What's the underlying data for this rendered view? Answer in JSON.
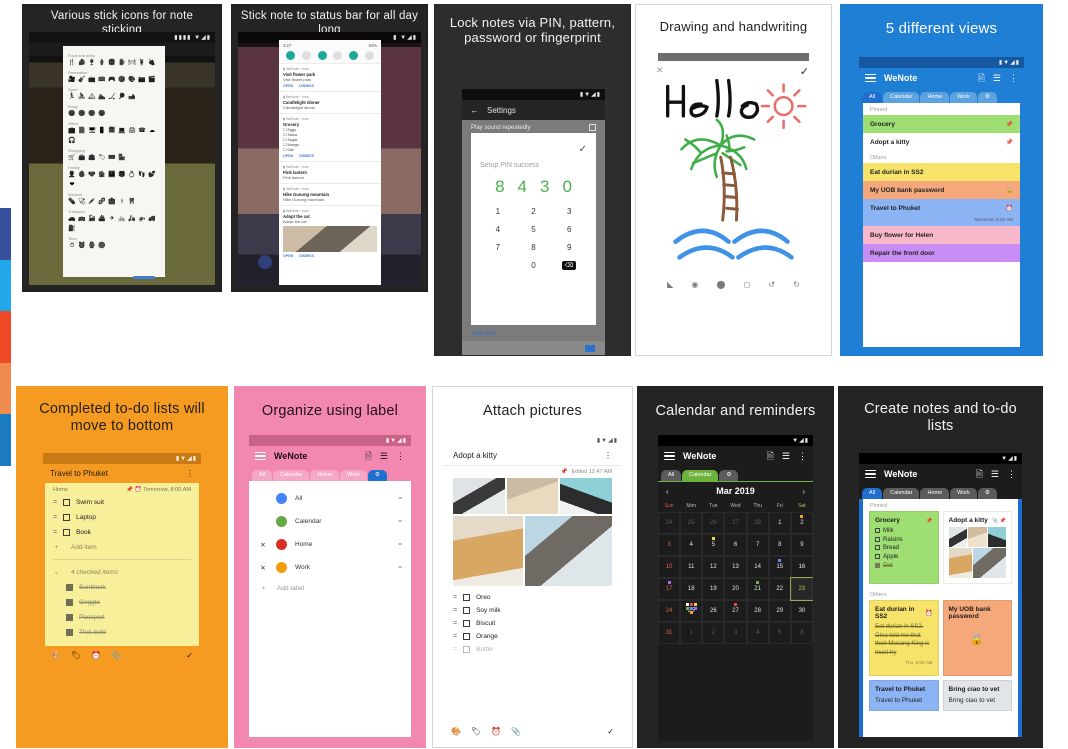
{
  "gallery": {
    "edge_strip_colors": [
      "#36509b",
      "#22a7e8",
      "#ef4824",
      "#ef8b4e",
      "#1c7cc0"
    ]
  },
  "cards": [
    {
      "id": "stick-icons",
      "title": "Various stick icons for note sticking",
      "bg": "#242424",
      "title_color": "#f2f2f2",
      "icon_picker": {
        "groups": [
          {
            "name": "Food and drink",
            "icons": [
              "🍴",
              "🍰",
              "🍷",
              "🍦",
              "🍔",
              "🍺",
              "🍽",
              "🍹",
              "🍇"
            ]
          },
          {
            "name": "Recreation",
            "icons": [
              "🎥",
              "🎸",
              "📺",
              "📖",
              "🎮",
              "🎲",
              "🎨",
              "📷",
              "🎬"
            ]
          },
          {
            "name": "Sport",
            "icons": [
              "🏃",
              "🚴",
              "🏔",
              "🏊",
              "🏒",
              "🏓",
              "🎿"
            ]
          },
          {
            "name": "Emoji",
            "icons": [
              "😀",
              "😊",
              "🙁",
              "😮"
            ]
          },
          {
            "name": "Office",
            "icons": [
              "💼",
              "📄",
              "🖥",
              "📱",
              "📅",
              "💻",
              "🖨",
              "☎",
              "☁",
              "🎧"
            ]
          },
          {
            "name": "Shopping",
            "icons": [
              "🛒",
              "👜",
              "👛",
              "🏷",
              "💳",
              "🏪"
            ]
          },
          {
            "name": "Family",
            "icons": [
              "👤",
              "👶",
              "🐶",
              "🏠",
              "👪",
              "🎁",
              "💍",
              "👣",
              "💕",
              "❤"
            ]
          },
          {
            "name": "Medical",
            "icons": [
              "💊",
              "🩺",
              "💉",
              "🧬",
              "🏥",
              "⚕",
              "🦷"
            ]
          },
          {
            "name": "Transport",
            "icons": [
              "🚗",
              "🚌",
              "🚂",
              "🚢",
              "✈",
              "🚲",
              "🛵",
              "🚁",
              "🚚",
              "⛽"
            ]
          },
          {
            "name": "Time",
            "icons": [
              "⏱",
              "⏰",
              "⌚",
              "🕒"
            ]
          }
        ]
      }
    },
    {
      "id": "status-bar-note",
      "title": "Stick note to status bar for all day long",
      "bg": "#242424",
      "title_color": "#f2f2f2",
      "notification_shade": {
        "clock": "4:27",
        "battery": "84%",
        "quick_toggles": [
          "wifi-toggle",
          "bluetooth-toggle",
          "dnd-toggle",
          "flashlight-toggle",
          "rotate-toggle",
          "airplane-toggle"
        ],
        "notifications": [
          {
            "app": "WeNote · now",
            "title": "Visit flower park",
            "body": "Visit flower park",
            "actions": [
              "OPEN",
              "DISMISS"
            ]
          },
          {
            "app": "WeNote · now",
            "title": "Candlelight dinner",
            "body": "Candlelight dinner"
          },
          {
            "app": "WeNote · now",
            "title": "Grocery",
            "items": [
              "Eggs",
              "Salsa",
              "Sugar",
              "Mango",
              "Oat"
            ],
            "actions": [
              "OPEN",
              "DISMISS"
            ]
          },
          {
            "app": "WeNote · now",
            "title": "Pink lantern",
            "body": "Pink lantern"
          },
          {
            "app": "WeNote · now",
            "title": "Hike Gunung mountain",
            "body": "Hike Gunung mountain"
          },
          {
            "app": "WeNote · now",
            "title": "Adopt the cat",
            "body": "Adopt the cat",
            "actions": [
              "OPEN",
              "DISMISS"
            ]
          }
        ]
      }
    },
    {
      "id": "lock-notes",
      "title": "Lock notes via PIN, pattern, password or fingerprint",
      "bg": "#2d2d2d",
      "title_color": "#f2f2f2",
      "settings_screen": {
        "toolbar_title": "Settings",
        "back_icon": "arrow-left-icon",
        "dim_row": "Play sound repeatedly",
        "auto_lock": "Auto lock"
      },
      "pin_dialog": {
        "message": "Setup PIN success",
        "entered": [
          "8",
          "4",
          "3",
          "0"
        ],
        "entered_color": "#4caf50",
        "keys": [
          "1",
          "2",
          "3",
          "4",
          "5",
          "6",
          "7",
          "8",
          "9",
          "",
          "0",
          "⌫"
        ],
        "confirm_icon": "check-icon"
      }
    },
    {
      "id": "drawing",
      "title": "Drawing and handwriting",
      "bg": "#ffffff",
      "title_color": "#1f1f1f",
      "canvas": {
        "handwriting_text": "Hello",
        "close_icon": "close-icon",
        "confirm_icon": "check-icon",
        "tools": [
          "brush-icon",
          "opacity-icon",
          "color-icon",
          "eraser-icon",
          "undo-icon",
          "redo-icon"
        ]
      }
    },
    {
      "id": "five-views",
      "title": "5 different views",
      "bg": "#1f7fd4",
      "title_color": "#ffffff",
      "app": {
        "name": "WeNote",
        "menu_icon": "hamburger-icon",
        "actions": [
          "new-note-icon",
          "view-list-icon",
          "overflow-menu-icon"
        ],
        "tabs": [
          "All",
          "Calendar",
          "Home",
          "Work"
        ],
        "active_tab": "All",
        "settings_tab_icon": "gear-icon",
        "sections": [
          {
            "label": "Pinned",
            "notes": [
              {
                "title": "Grocery",
                "color": "#9ede73",
                "badge": "pin-icon"
              },
              {
                "title": "Adopt a kitty",
                "color": "#ffffff",
                "badge": "pin-icon"
              }
            ]
          },
          {
            "label": "Others",
            "notes": [
              {
                "title": "Eat durian in SS2",
                "color": "#f7e36a",
                "badge": ""
              },
              {
                "title": "My UOB bank password",
                "color": "#f5a97a",
                "badge": "lock-icon"
              },
              {
                "title": "Travel to Phuket",
                "color": "#8cb4f5",
                "badge": "alarm-icon",
                "sub": "Tomorrow, 8:00 AM"
              },
              {
                "title": "Buy flower for Helen",
                "color": "#f8b8ca",
                "badge": ""
              },
              {
                "title": "Repair the front door",
                "color": "#c98ef5",
                "badge": ""
              }
            ]
          }
        ]
      }
    },
    {
      "id": "completed-todo",
      "title": "Completed to-do lists will move to bottom",
      "bg": "#f59b22",
      "title_color": "#1f1f1f",
      "note": {
        "title": "Travel to Phuket",
        "overflow_icon": "overflow-menu-icon",
        "label": "Home",
        "pin_icon": "pin-icon",
        "reminder_icon": "alarm-icon",
        "reminder": "Tomorrow, 8:00 AM",
        "paper_color": "#f7ef9a",
        "items": [
          {
            "text": "Swim suit",
            "checked": false
          },
          {
            "text": "Laptop",
            "checked": false
          },
          {
            "text": "Book",
            "checked": false
          }
        ],
        "add_item": "Add item",
        "checked_header": "4 checked items",
        "checked_items": [
          {
            "text": "Sunblock",
            "checked": true
          },
          {
            "text": "Goggle",
            "checked": true
          },
          {
            "text": "Passport",
            "checked": true
          },
          {
            "text": "Thai baht",
            "checked": true
          }
        ],
        "bottom_tools": [
          "palette-icon",
          "label-icon",
          "alarm-icon",
          "attachment-icon"
        ],
        "save_icon": "check-icon"
      }
    },
    {
      "id": "labels",
      "title": "Organize using label",
      "bg": "#f287b0",
      "title_color": "#1f1f1f",
      "app": {
        "name": "WeNote",
        "menu_icon": "hamburger-icon",
        "actions": [
          "new-note-icon",
          "view-list-icon",
          "overflow-menu-icon"
        ],
        "tabs": [
          "All",
          "Calendar",
          "Home",
          "Work"
        ],
        "active_tab": "gear",
        "settings_tab_icon": "gear-icon",
        "labels": [
          {
            "name": "All",
            "color": "#4285f4",
            "removable": false
          },
          {
            "name": "Calendar",
            "color": "#63a844",
            "removable": false
          },
          {
            "name": "Home",
            "color": "#d93025",
            "removable": true
          },
          {
            "name": "Work",
            "color": "#f39c12",
            "removable": true
          }
        ],
        "add_label": "Add label"
      }
    },
    {
      "id": "attach-pictures",
      "title": "Attach pictures",
      "bg": "#ffffff",
      "title_color": "#1f1f1f",
      "note": {
        "title": "Adopt a kitty",
        "overflow_icon": "overflow-menu-icon",
        "pin_icon": "pin-icon",
        "edited": "Edited 12:47 AM",
        "photo_count": 5,
        "items": [
          {
            "text": "Oreo",
            "checked": false
          },
          {
            "text": "Soy milk",
            "checked": false
          },
          {
            "text": "Biscuit",
            "checked": false
          },
          {
            "text": "Orange",
            "checked": false
          },
          {
            "text": "Butter",
            "checked": false
          }
        ],
        "bottom_tools": [
          "palette-icon",
          "label-icon",
          "alarm-icon",
          "attachment-icon"
        ],
        "save_icon": "check-icon"
      }
    },
    {
      "id": "calendar",
      "title": "Calendar and reminders",
      "bg": "#242424",
      "title_color": "#f2f2f2",
      "app": {
        "name": "WeNote",
        "menu_icon": "hamburger-icon",
        "actions": [
          "new-note-icon",
          "view-list-icon",
          "overflow-menu-icon"
        ],
        "tabs": [
          "All",
          "Calendar"
        ],
        "active_tab": "Calendar",
        "settings_tab_icon": "gear-icon",
        "month": "Mar 2019",
        "prev_icon": "chevron-left-icon",
        "next_icon": "chevron-right-icon",
        "dow": [
          "Sun",
          "Mon",
          "Tue",
          "Wed",
          "Thu",
          "Fri",
          "Sat"
        ],
        "today": 23,
        "weeks": [
          [
            {
              "d": "24",
              "muted": true
            },
            {
              "d": "25",
              "muted": true
            },
            {
              "d": "26",
              "muted": true
            },
            {
              "d": "27",
              "muted": true
            },
            {
              "d": "28",
              "muted": true
            },
            {
              "d": "1"
            },
            {
              "d": "2",
              "pips": [
                "#f5a623"
              ]
            }
          ],
          [
            {
              "d": "3",
              "sun": true
            },
            {
              "d": "4"
            },
            {
              "d": "5",
              "pips": [
                "#f2d44a"
              ]
            },
            {
              "d": "6"
            },
            {
              "d": "7"
            },
            {
              "d": "8"
            },
            {
              "d": "9"
            }
          ],
          [
            {
              "d": "10",
              "sun": true
            },
            {
              "d": "11"
            },
            {
              "d": "12"
            },
            {
              "d": "13"
            },
            {
              "d": "14"
            },
            {
              "d": "15",
              "pips": [
                "#5b8def"
              ]
            },
            {
              "d": "16"
            }
          ],
          [
            {
              "d": "17",
              "sun": true,
              "pips": [
                "#9b6ef5"
              ]
            },
            {
              "d": "18"
            },
            {
              "d": "19"
            },
            {
              "d": "20"
            },
            {
              "d": "21",
              "pips": [
                "#6db33f"
              ]
            },
            {
              "d": "22"
            },
            {
              "d": "23",
              "today": true
            }
          ],
          [
            {
              "d": "24",
              "sun": true
            },
            {
              "d": "25",
              "pips": [
                "#ffffff",
                "#e74c3c",
                "#f2d44a",
                "#6db33f",
                "#5b8def",
                "#9b6ef5",
                "#f5a623"
              ]
            },
            {
              "d": "26"
            },
            {
              "d": "27",
              "pips": [
                "#e74c3c"
              ]
            },
            {
              "d": "28"
            },
            {
              "d": "29"
            },
            {
              "d": "30"
            }
          ],
          [
            {
              "d": "31",
              "sun": true
            },
            {
              "d": "1",
              "muted": true
            },
            {
              "d": "2",
              "muted": true
            },
            {
              "d": "3",
              "muted": true
            },
            {
              "d": "4",
              "muted": true
            },
            {
              "d": "5",
              "muted": true
            },
            {
              "d": "6",
              "muted": true
            }
          ]
        ]
      }
    },
    {
      "id": "create-notes",
      "title": "Create notes and to-do lists",
      "bg": "#242424",
      "title_color": "#f2f2f2",
      "app": {
        "name": "WeNote",
        "menu_icon": "hamburger-icon",
        "actions": [
          "new-note-icon",
          "view-list-icon",
          "overflow-menu-icon"
        ],
        "tabs": [
          "All",
          "Calendar",
          "Home",
          "Work"
        ],
        "active_tab": "All",
        "settings_tab_icon": "gear-icon",
        "pinned_label": "Pinned",
        "others_label": "Others",
        "pinned": [
          {
            "title": "Grocery",
            "color": "#9ede73",
            "badge": "pin-icon",
            "items": [
              {
                "text": "Milk",
                "checked": false
              },
              {
                "text": "Raisins",
                "checked": false
              },
              {
                "text": "Bread",
                "checked": false
              },
              {
                "text": "Apple",
                "checked": false
              },
              {
                "text": "Oat",
                "checked": true
              }
            ]
          },
          {
            "title": "Adopt a kitty",
            "color": "#ffffff",
            "badge": "pin-icon",
            "attachment_icon": "attachment-icon",
            "photos": 5
          }
        ],
        "others": [
          {
            "title": "Eat durian in SS2",
            "color": "#f7e36a",
            "badge": "alarm-icon",
            "body": "Eat durian in SS2. Gina told me that their Musang King is must try",
            "struck": true,
            "sub": "Thu, 8:00 AM"
          },
          {
            "title": "My UOB bank password",
            "color": "#f5a97a",
            "badge": "lock-icon",
            "locked": true
          },
          {
            "title": "Travel to Phuket",
            "color": "#8cb4f5",
            "body": "Travel to Phuket"
          },
          {
            "title": "Bring ciao to vet",
            "color": "#e2e5e8",
            "body": "Bring ciao to vet"
          }
        ]
      }
    }
  ]
}
